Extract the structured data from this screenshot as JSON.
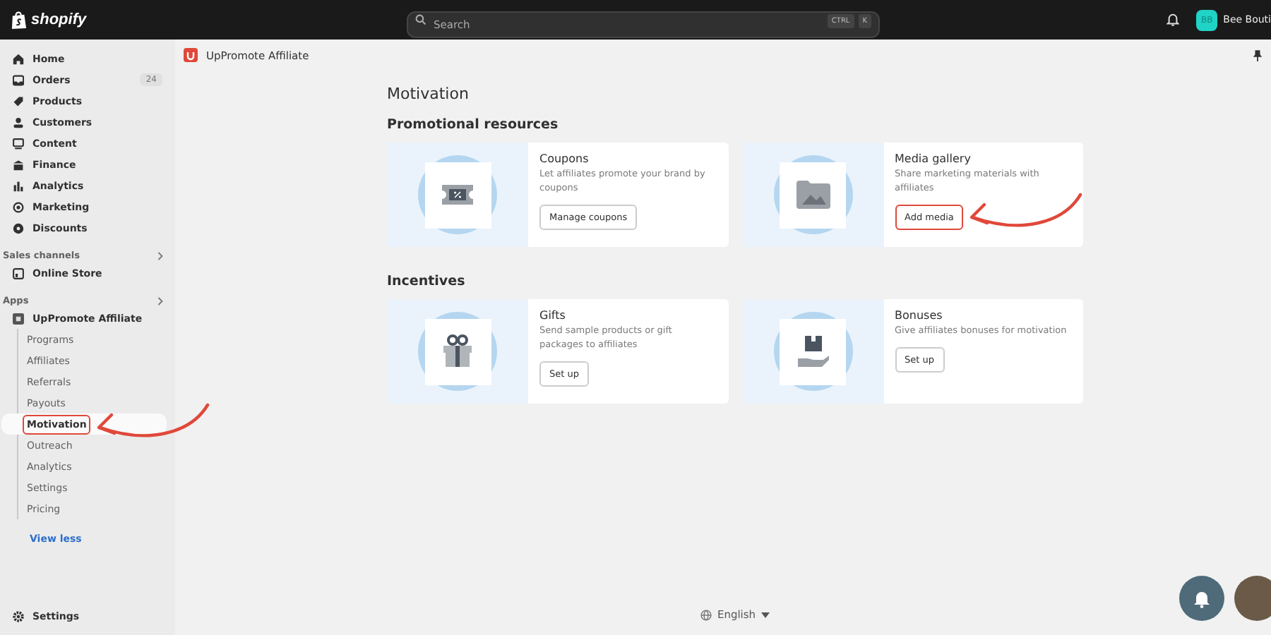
{
  "topbar": {
    "logo": "shopify",
    "search": {
      "placeholder": "Search"
    },
    "shortcut": [
      "CTRL",
      "K"
    ],
    "user": {
      "initials": "BB",
      "name": "Bee Bouti"
    }
  },
  "sidebar": {
    "items": [
      {
        "label": "Home"
      },
      {
        "label": "Orders",
        "badge": "24"
      },
      {
        "label": "Products"
      },
      {
        "label": "Customers"
      },
      {
        "label": "Content"
      },
      {
        "label": "Finance"
      },
      {
        "label": "Analytics"
      },
      {
        "label": "Marketing"
      },
      {
        "label": "Discounts"
      }
    ],
    "sales_channels": {
      "heading": "Sales channels",
      "items": [
        {
          "label": "Online Store"
        }
      ]
    },
    "apps": {
      "heading": "Apps",
      "app": {
        "label": "UpPromote Affiliate",
        "children": [
          {
            "label": "Programs",
            "selected": false,
            "highlighted": false
          },
          {
            "label": "Affiliates",
            "selected": false,
            "highlighted": false
          },
          {
            "label": "Referrals",
            "selected": false,
            "highlighted": false
          },
          {
            "label": "Payouts",
            "selected": false,
            "highlighted": false
          },
          {
            "label": "Motivation",
            "selected": true,
            "highlighted": true
          },
          {
            "label": "Outreach",
            "selected": false,
            "highlighted": false
          },
          {
            "label": "Analytics",
            "selected": false,
            "highlighted": false
          },
          {
            "label": "Settings",
            "selected": false,
            "highlighted": false
          },
          {
            "label": "Pricing",
            "selected": false,
            "highlighted": false
          }
        ]
      },
      "view_less": "View less"
    },
    "settings": "Settings"
  },
  "app_header": {
    "title": "UpPromote Affiliate"
  },
  "page": {
    "title": "Motivation",
    "sections": [
      {
        "heading": "Promotional resources",
        "cards": [
          {
            "kind": "coupon",
            "title": "Coupons",
            "description": "Let affiliates promote your brand by coupons",
            "button": {
              "label": "Manage coupons",
              "highlighted": false
            }
          },
          {
            "kind": "gallery",
            "title": "Media gallery",
            "description": "Share marketing materials with affiliates",
            "button": {
              "label": "Add media",
              "highlighted": true
            }
          }
        ]
      },
      {
        "heading": "Incentives",
        "cards": [
          {
            "kind": "gift",
            "title": "Gifts",
            "description": "Send sample products or gift packages to affiliates",
            "button": {
              "label": "Set up",
              "highlighted": false
            }
          },
          {
            "kind": "bonus",
            "title": "Bonuses",
            "description": "Give affiliates bonuses for motivation",
            "button": {
              "label": "Set up",
              "highlighted": false
            }
          }
        ]
      }
    ]
  },
  "footer": {
    "language": "English"
  }
}
